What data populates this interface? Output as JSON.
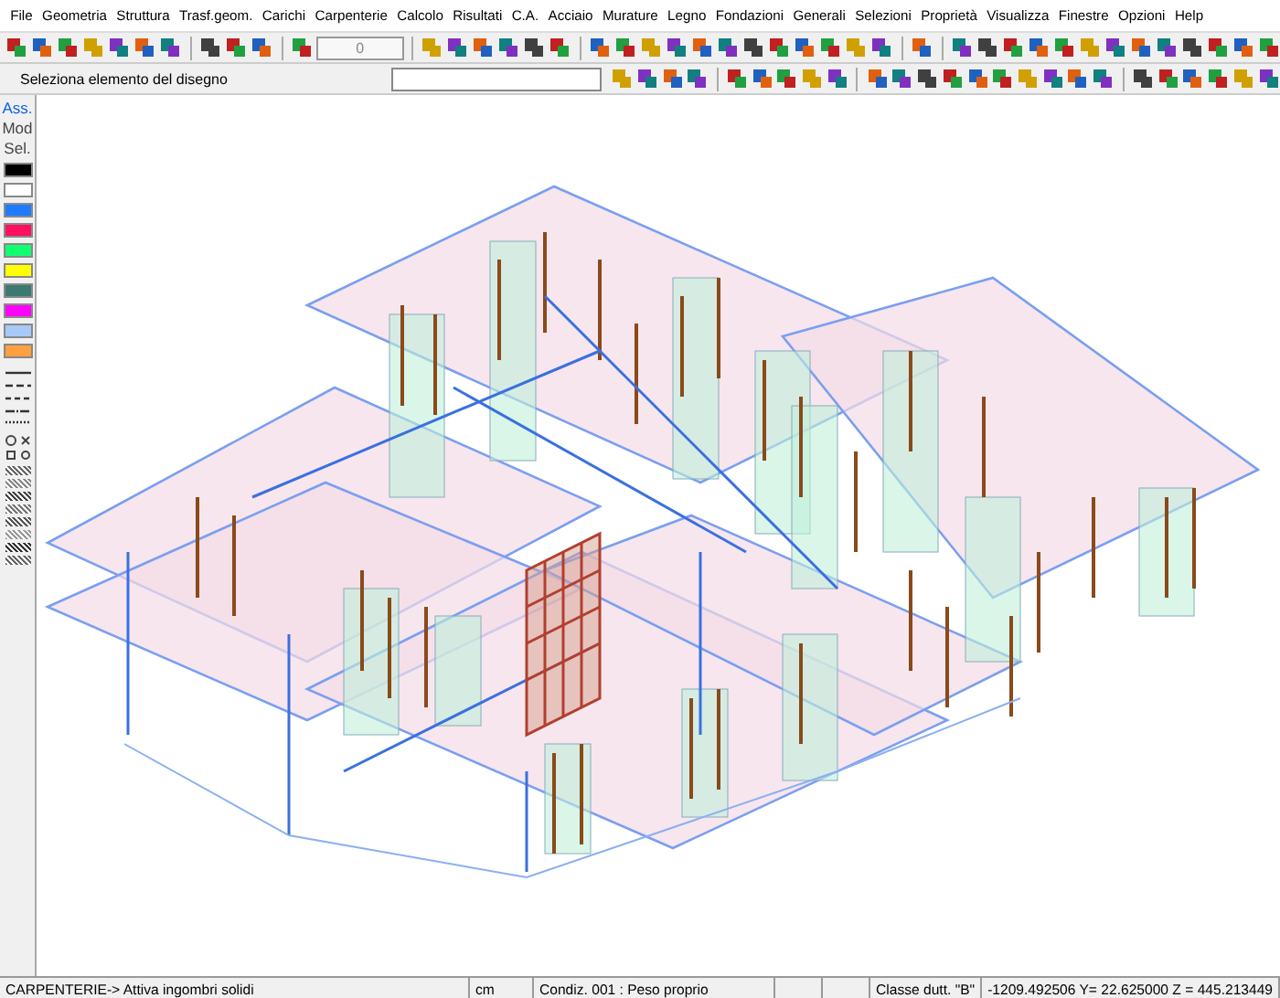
{
  "menu": [
    "File",
    "Geometria",
    "Struttura",
    "Trasf.geom.",
    "Carichi",
    "Carpenterie",
    "Calcolo",
    "Risultati",
    "C.A.",
    "Acciaio",
    "Murature",
    "Legno",
    "Fondazioni",
    "Generali",
    "Selezioni",
    "Proprietà",
    "Visualizza",
    "Finestre",
    "Opzioni",
    "Help"
  ],
  "toolbar": {
    "counter": "0",
    "prompt": "Seleziona  elemento del disegno"
  },
  "side_tabs": [
    {
      "label": "Ass.",
      "selected": true
    },
    {
      "label": "Mod",
      "selected": false
    },
    {
      "label": "Sel.",
      "selected": false
    }
  ],
  "palette": [
    {
      "color": "#000000"
    },
    {
      "color": "#ffffff"
    },
    {
      "color": "#1e7bff"
    },
    {
      "color": "#ff1060"
    },
    {
      "color": "#10ff70"
    },
    {
      "color": "#ffff00"
    },
    {
      "color": "#3a7a70"
    },
    {
      "color": "#ff00ff"
    },
    {
      "color": "#a8c8f8"
    },
    {
      "color": "#ffa040"
    }
  ],
  "status_bar": [
    "CARPENTERIE-> Attiva ingombri solidi",
    "cm",
    "Condiz. 001 : Peso proprio",
    "Classe dutt. \"B\"",
    "-1209.492506 Y= 22.625000 Z = 445.213449"
  ]
}
